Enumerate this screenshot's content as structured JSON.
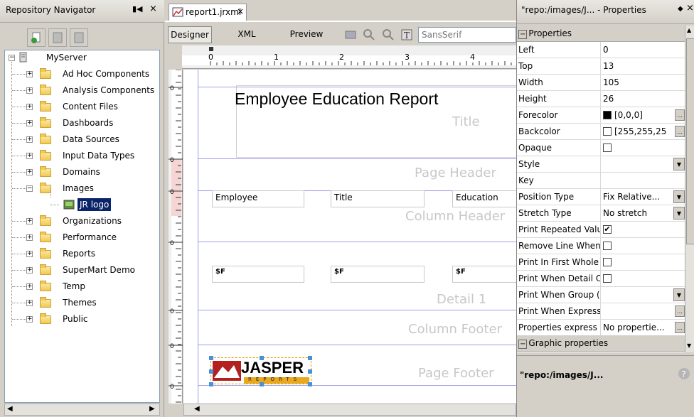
{
  "navigator": {
    "title": "Repository Navigator",
    "pin": "◖◗",
    "close": "×",
    "root": "MyServer",
    "items": [
      {
        "label": "Ad Hoc Components",
        "expanded": false
      },
      {
        "label": "Analysis Components",
        "expanded": false
      },
      {
        "label": "Content Files",
        "expanded": false
      },
      {
        "label": "Dashboards",
        "expanded": false
      },
      {
        "label": "Data Sources",
        "expanded": false
      },
      {
        "label": "Input Data Types",
        "expanded": false
      },
      {
        "label": "Domains",
        "expanded": false
      },
      {
        "label": "Images",
        "expanded": true
      },
      {
        "label": "JR logo",
        "child": true,
        "selected": true
      },
      {
        "label": "Organizations",
        "expanded": false
      },
      {
        "label": "Performance",
        "expanded": false
      },
      {
        "label": "Reports",
        "expanded": false
      },
      {
        "label": "SuperMart Demo",
        "expanded": false
      },
      {
        "label": "Temp",
        "expanded": false
      },
      {
        "label": "Themes",
        "expanded": false
      },
      {
        "label": "Public",
        "expanded": false
      }
    ]
  },
  "editor": {
    "tab": "report1.jrxml",
    "close": "×",
    "tabs": [
      "Designer",
      "XML",
      "Preview"
    ],
    "font": "SansSerif",
    "ruler": [
      "0",
      "1",
      "2",
      "3",
      "4"
    ],
    "title_text": "Employee Education Report",
    "bands": [
      "Title",
      "Page Header",
      "Column Header",
      "Detail 1",
      "Column Footer",
      "Page Footer"
    ],
    "headers": [
      "Employee",
      "Title",
      "Education"
    ],
    "fields": [
      "$F",
      "$F",
      "$F"
    ],
    "logo_main": "JASPER",
    "logo_sub": "REPORTS"
  },
  "properties": {
    "title": "\"repo:/images/J... - Properties",
    "section1": "Properties",
    "rows": [
      {
        "name": "Left",
        "value": "0"
      },
      {
        "name": "Top",
        "value": "13"
      },
      {
        "name": "Width",
        "value": "105"
      },
      {
        "name": "Height",
        "value": "26"
      },
      {
        "name": "Forecolor",
        "value": "[0,0,0]",
        "swatch": "#000000",
        "ellipsis": true
      },
      {
        "name": "Backcolor",
        "value": "[255,255,25",
        "swatch": "#ffffff",
        "ellipsis": true
      },
      {
        "name": "Opaque",
        "check": false
      },
      {
        "name": "Style",
        "value": "",
        "dropdown": true
      },
      {
        "name": "Key",
        "value": ""
      },
      {
        "name": "Position Type",
        "value": "Fix Relative...",
        "dropdown": true
      },
      {
        "name": "Stretch Type",
        "value": "No stretch",
        "dropdown": true
      },
      {
        "name": "Print Repeated Valu",
        "check": true
      },
      {
        "name": "Remove Line When",
        "check": false
      },
      {
        "name": "Print In First Whole",
        "check": false
      },
      {
        "name": "Print When Detail O",
        "check": false
      },
      {
        "name": "Print When Group (",
        "value": "",
        "dropdown": true
      },
      {
        "name": "Print When Express",
        "value": "",
        "ellipsis": true
      },
      {
        "name": "Properties express",
        "value": "No propertie...",
        "ellipsis": true
      }
    ],
    "section2": "Graphic properties",
    "footer": "\"repo:/images/J..."
  }
}
